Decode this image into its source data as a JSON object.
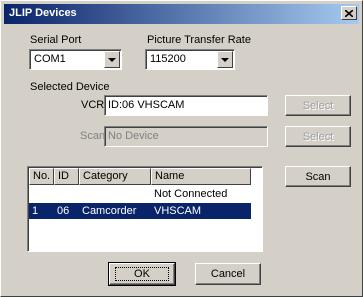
{
  "window": {
    "title": "JLIP Devices"
  },
  "serial_port": {
    "label": "Serial Port",
    "value": "COM1"
  },
  "transfer_rate": {
    "label": "Picture Transfer Rate",
    "value": "115200"
  },
  "selected_device": {
    "label": "Selected Device",
    "vcr": {
      "label": "VCR",
      "value": "ID:06 VHSCAM",
      "button": "Select"
    },
    "scan": {
      "label": "Scan",
      "value": "No Device",
      "button": "Select"
    }
  },
  "list": {
    "columns": [
      "No.",
      "ID",
      "Category",
      "Name"
    ],
    "rows": [
      {
        "no": "",
        "id": "",
        "category": "",
        "name": "Not Connected",
        "selected": false
      },
      {
        "no": "1",
        "id": "06",
        "category": "Camcorder",
        "name": "VHSCAM",
        "selected": true
      }
    ]
  },
  "scan_button": "Scan",
  "ok_button": "OK",
  "cancel_button": "Cancel",
  "colors": {
    "titlebar_start": "#0a246a",
    "titlebar_end": "#a6caf0",
    "selection": "#0a246a",
    "face": "#d4d0c8"
  }
}
